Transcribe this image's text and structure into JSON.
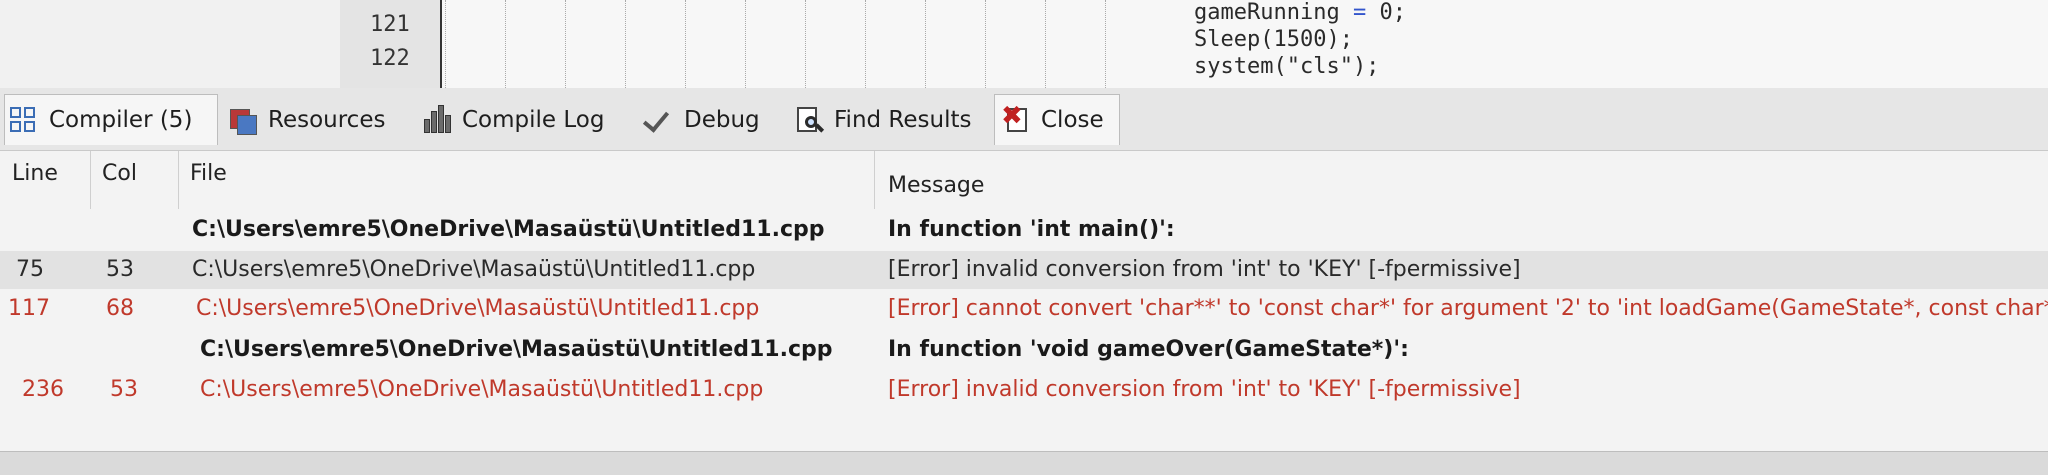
{
  "editor": {
    "line_numbers": [
      "121",
      "122"
    ],
    "code_lines": [
      {
        "ident": "gameRunning",
        "op": " = ",
        "rest": "0;"
      },
      {
        "ident": "Sleep(1500);",
        "op": "",
        "rest": ""
      },
      {
        "ident": "system(\"cls\");",
        "op": "",
        "rest": ""
      }
    ]
  },
  "tabs": [
    {
      "label": "Compiler (5)",
      "icon": "grid-icon"
    },
    {
      "label": "Resources",
      "icon": "resources-icon"
    },
    {
      "label": "Compile Log",
      "icon": "bar-chart-icon"
    },
    {
      "label": "Debug",
      "icon": "checkmark-icon"
    },
    {
      "label": "Find Results",
      "icon": "find-icon"
    },
    {
      "label": "Close",
      "icon": "close-icon"
    }
  ],
  "table": {
    "columns": [
      "Line",
      "Col",
      "File",
      "Message"
    ],
    "rows": [
      {
        "line": "",
        "col": "",
        "file": "C:\\Users\\emre5\\OneDrive\\Masaüstü\\Untitled11.cpp",
        "message": "In function 'int main()':",
        "kind": "header"
      },
      {
        "line": "75",
        "col": "53",
        "file": "C:\\Users\\emre5\\OneDrive\\Masaüstü\\Untitled11.cpp",
        "message": "[Error] invalid conversion from 'int' to 'KEY' [-fpermissive]",
        "kind": "normal"
      },
      {
        "line": "117",
        "col": "68",
        "file": "C:\\Users\\emre5\\OneDrive\\Masaüstü\\Untitled11.cpp",
        "message": "[Error] cannot convert 'char**' to 'const char*' for argument '2' to 'int loadGame(GameState*, const char*)'",
        "kind": "error"
      },
      {
        "line": "",
        "col": "",
        "file": "C:\\Users\\emre5\\OneDrive\\Masaüstü\\Untitled11.cpp",
        "message": "In function 'void gameOver(GameState*)':",
        "kind": "header"
      },
      {
        "line": "236",
        "col": "53",
        "file": "C:\\Users\\emre5\\OneDrive\\Masaüstü\\Untitled11.cpp",
        "message": "[Error] invalid conversion from 'int' to 'KEY' [-fpermissive]",
        "kind": "error"
      }
    ]
  },
  "colors": {
    "error_text": "#c0392b",
    "selected_row": "#e2e2e2",
    "accent_icon": "#3b6db5"
  }
}
